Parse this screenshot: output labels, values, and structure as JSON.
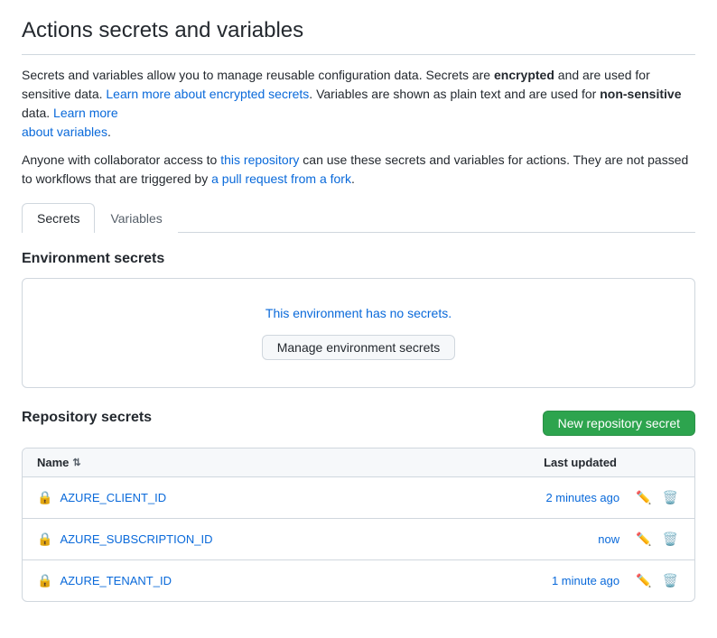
{
  "page": {
    "title": "Actions secrets and variables",
    "description1": "Secrets and variables allow you to manage reusable configuration data. Secrets are ",
    "description1_encrypted": "encrypted",
    "description1_b": " and are used for sensitive data. ",
    "learn_more_encrypted": "Learn more about encrypted secrets",
    "description2": ". Variables are shown as plain text and are used for ",
    "description2_bold": "non-sensitive",
    "description2_b": " data. ",
    "learn_more_variables": "Learn more about variables",
    "description2_end": ".",
    "note_text1": "Anyone with collaborator access to ",
    "note_link": "this repository",
    "note_text2": " can use these secrets and variables for actions. They are not passed to workflows that are triggered by ",
    "note_link2": "a pull request from a fork",
    "note_text3": "."
  },
  "tabs": [
    {
      "label": "Secrets",
      "active": true
    },
    {
      "label": "Variables",
      "active": false
    }
  ],
  "environment_secrets": {
    "title": "Environment secrets",
    "empty_text": "This environment has no secrets.",
    "manage_button": "Manage environment secrets"
  },
  "repository_secrets": {
    "title": "Repository secrets",
    "new_button": "New repository secret",
    "table": {
      "col_name": "Name",
      "col_updated": "Last updated",
      "rows": [
        {
          "name": "AZURE_CLIENT_ID",
          "updated": "2 minutes ago"
        },
        {
          "name": "AZURE_SUBSCRIPTION_ID",
          "updated": "now"
        },
        {
          "name": "AZURE_TENANT_ID",
          "updated": "1 minute ago"
        }
      ]
    }
  }
}
